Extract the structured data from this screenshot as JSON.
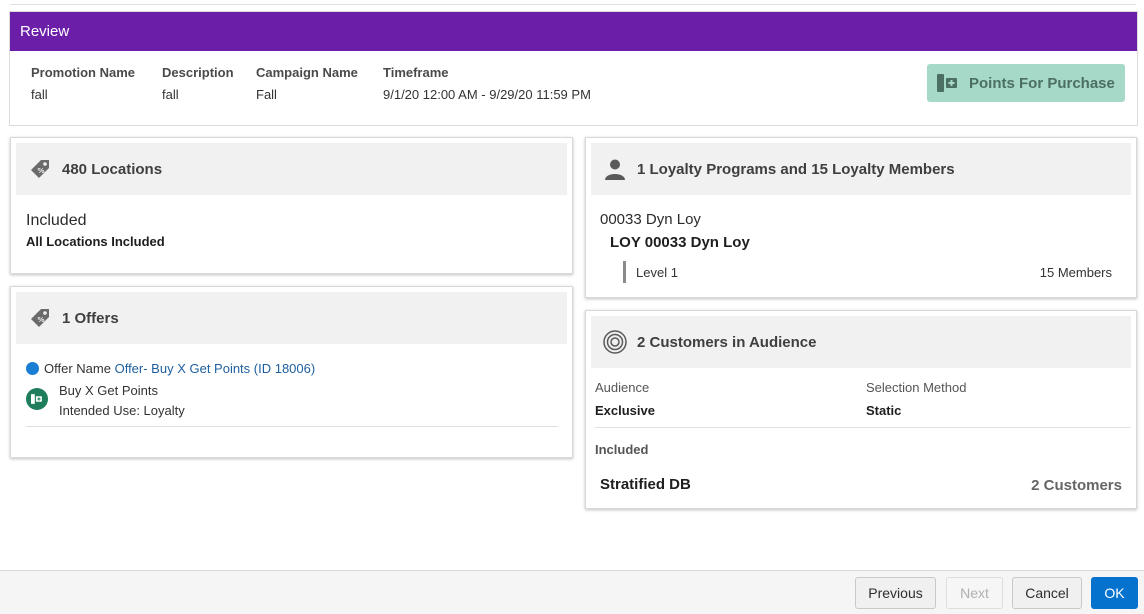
{
  "review": {
    "title": "Review",
    "columns": [
      {
        "label": "Promotion Name",
        "value": "fall"
      },
      {
        "label": "Description",
        "value": "fall"
      },
      {
        "label": "Campaign Name",
        "value": "Fall"
      },
      {
        "label": "Timeframe",
        "value": "9/1/20 12:00 AM - 9/29/20 11:59 PM"
      }
    ],
    "type_button": "Points For Purchase"
  },
  "locations": {
    "title": "480 Locations",
    "status": "Included",
    "detail": "All Locations Included"
  },
  "offers": {
    "title": "1 Offers",
    "offer_name_label": "Offer Name",
    "offer_name_link": "Offer- Buy X Get Points (ID 18006)",
    "offer_type": "Buy X Get Points",
    "intended_use": "Intended Use: Loyalty"
  },
  "loyalty": {
    "title": "1 Loyalty Programs and 15 Loyalty Members",
    "program": "00033 Dyn Loy",
    "program_bold": "LOY 00033 Dyn Loy",
    "level": "Level 1",
    "members": "15 Members"
  },
  "audience": {
    "title": "2 Customers in Audience",
    "audience_label": "Audience",
    "audience_value": "Exclusive",
    "method_label": "Selection Method",
    "method_value": "Static",
    "included_label": "Included",
    "segment_name": "Stratified DB",
    "segment_count": "2 Customers"
  },
  "footer": {
    "previous": "Previous",
    "next": "Next",
    "cancel": "Cancel",
    "ok": "OK"
  },
  "colors": {
    "header_purple": "#6b1fa8",
    "type_button_bg": "#a7d9c9",
    "primary_blue": "#0572ce",
    "link_blue": "#1f5f9e",
    "offer_dot": "#1a7fd4",
    "offer_icon_green": "#1e7d5a"
  }
}
